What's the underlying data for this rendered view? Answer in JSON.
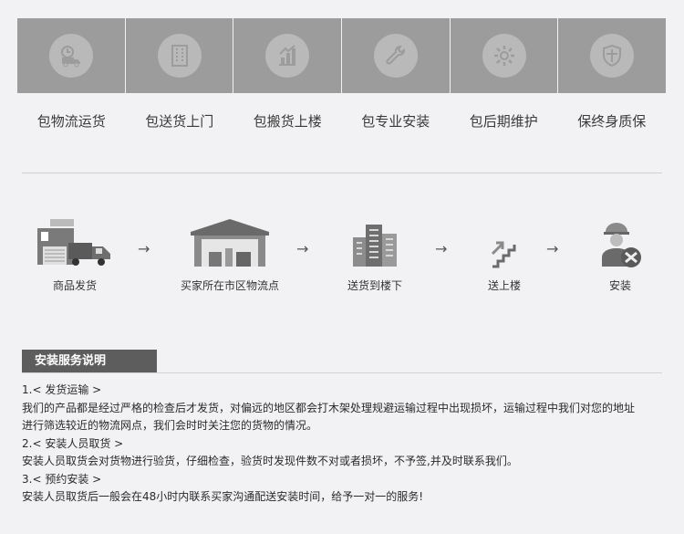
{
  "services": [
    {
      "label": "包物流运货",
      "icon": "clock-truck-icon"
    },
    {
      "label": "包送货上门",
      "icon": "building-icon"
    },
    {
      "label": "包搬货上楼",
      "icon": "stairs-chart-icon"
    },
    {
      "label": "包专业安装",
      "icon": "wrench-icon"
    },
    {
      "label": "包后期维护",
      "icon": "gear-icon"
    },
    {
      "label": "保终身质保",
      "icon": "shield-icon"
    }
  ],
  "flow": [
    {
      "label": "商品发货"
    },
    {
      "label": "买家所在市区物流点"
    },
    {
      "label": "送货到楼下"
    },
    {
      "label": "送上楼"
    },
    {
      "label": "安装"
    }
  ],
  "arrow": "→",
  "section_title": "安装服务说明",
  "notes": [
    "1.< 发货运输 >",
    "我们的产品都是经过严格的检查后才发货，对偏远的地区都会打木架处理规避运输过程中出现损坏，运输过程中我们对您的地址",
    "进行筛选较近的物流网点，我们会时时关注您的货物的情况。",
    "2.< 安装人员取货 >",
    "安装人员取货会对货物进行验货，仔细检查，验货时发现件数不对或者损坏，不予签,并及时联系我们。",
    "3.< 预约安装 >",
    "安装人员取货后一般会在48小时内联系买家沟通配送安装时间，给予一对一的服务!"
  ]
}
